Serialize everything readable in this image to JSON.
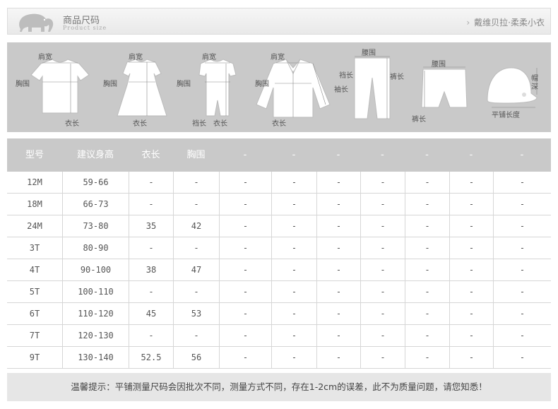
{
  "header": {
    "title_cn": "商品尺码",
    "title_en": "Product size",
    "brand": "戴维贝拉·柔柔小衣",
    "logo_icon": "elephant-icon"
  },
  "figures": [
    {
      "garment": "tshirt-icon",
      "labels": [
        "肩宽",
        "胸围",
        "衣长"
      ]
    },
    {
      "garment": "dress-icon",
      "labels": [
        "肩宽",
        "胸围",
        "衣长"
      ]
    },
    {
      "garment": "romper-icon",
      "labels": [
        "肩宽",
        "胸围",
        "裆长",
        "衣长"
      ]
    },
    {
      "garment": "coat-icon",
      "labels": [
        "肩宽",
        "胸围",
        "袖长",
        "衣长"
      ]
    },
    {
      "garment": "pants-icon",
      "labels": [
        "腰围",
        "裆长",
        "裤长"
      ]
    },
    {
      "garment": "shorts-icon",
      "labels": [
        "腰围",
        "裤长"
      ]
    },
    {
      "garment": "hat-icon",
      "labels": [
        "帽深",
        "平铺长度"
      ]
    }
  ],
  "table": {
    "headers": [
      "型号",
      "建议身高",
      "衣长",
      "胸围",
      "-",
      "-",
      "-",
      "-",
      "-",
      "-",
      "-"
    ],
    "rows": [
      [
        "12M",
        "59-66",
        "-",
        "-",
        "-",
        "-",
        "-",
        "-",
        "-",
        "-",
        "-"
      ],
      [
        "18M",
        "66-73",
        "-",
        "-",
        "-",
        "-",
        "-",
        "-",
        "-",
        "-",
        "-"
      ],
      [
        "24M",
        "73-80",
        "35",
        "42",
        "-",
        "-",
        "-",
        "-",
        "-",
        "-",
        "-"
      ],
      [
        "3T",
        "80-90",
        "-",
        "-",
        "-",
        "-",
        "-",
        "-",
        "-",
        "-",
        "-"
      ],
      [
        "4T",
        "90-100",
        "38",
        "47",
        "-",
        "-",
        "-",
        "-",
        "-",
        "-",
        "-"
      ],
      [
        "5T",
        "100-110",
        "-",
        "-",
        "-",
        "-",
        "-",
        "-",
        "-",
        "-",
        "-"
      ],
      [
        "6T",
        "110-120",
        "45",
        "53",
        "-",
        "-",
        "-",
        "-",
        "-",
        "-",
        "-"
      ],
      [
        "7T",
        "120-130",
        "-",
        "-",
        "-",
        "-",
        "-",
        "-",
        "-",
        "-",
        "-"
      ],
      [
        "9T",
        "130-140",
        "52.5",
        "56",
        "-",
        "-",
        "-",
        "-",
        "-",
        "-",
        "-"
      ]
    ]
  },
  "note": "温馨提示：平铺测量尺码会因批次不同，测量方式不同，存在1-2cm的误差，此不为质量问题，请您知悉！",
  "colors": {
    "band": "#c9c9c9",
    "grid": "#d6d6d6",
    "note_bg": "#e6e6e6"
  }
}
